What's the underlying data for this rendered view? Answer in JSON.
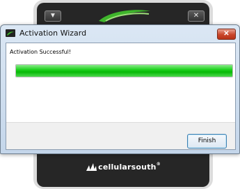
{
  "device": {
    "menu_icon": "menu-down-icon",
    "close_glyph": "✕",
    "menu_glyph": "▼",
    "brand_text": "cellularsouth",
    "brand_suffix": "®"
  },
  "dialog": {
    "title": "Activation Wizard",
    "close_glyph": "✕",
    "status": "Activation Successful!",
    "progress_fraction": 1.0,
    "finish_label": "Finish"
  },
  "colors": {
    "progress_green": "#12c812",
    "titlebar": "#c8d9ec",
    "device_dark": "#262626"
  }
}
